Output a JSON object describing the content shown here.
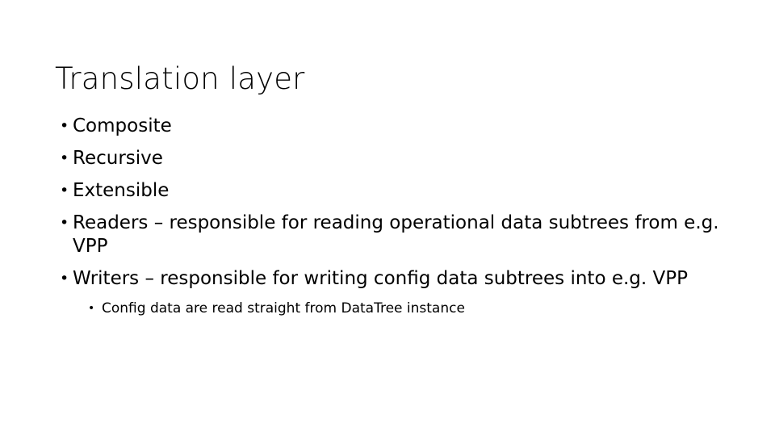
{
  "slide": {
    "title": "Translation layer",
    "background_color": "#ffffff",
    "text_color": "#000000",
    "bullet_marker": "•",
    "bullets": [
      {
        "level": 1,
        "text": "Composite"
      },
      {
        "level": 1,
        "text": "Recursive"
      },
      {
        "level": 1,
        "text": "Extensible"
      },
      {
        "level": 1,
        "text": "Readers – responsible for reading operational data subtrees from e.g. VPP"
      },
      {
        "level": 1,
        "text": "Writers – responsible for writing config data subtrees into e.g. VPP"
      },
      {
        "level": 2,
        "text": "Config data are read straight from DataTree instance"
      }
    ]
  }
}
